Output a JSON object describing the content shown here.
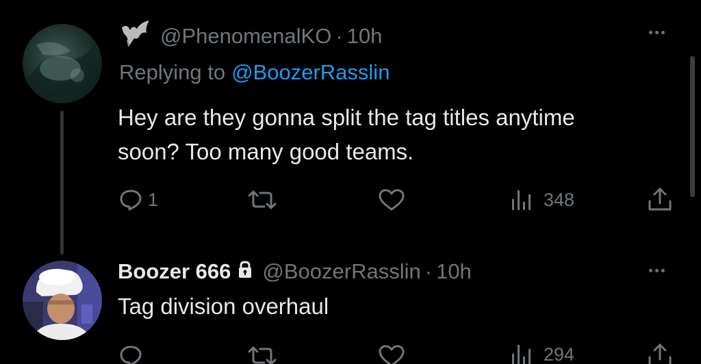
{
  "tweets": [
    {
      "handle": "@PhenomenalKO",
      "separator": "·",
      "time": "10h",
      "replying_prefix": "Replying to",
      "replying_handle": "@BoozerRasslin",
      "text_line1": "Hey are they gonna split the tag titles anytime",
      "text_line2": "soon? Too many good teams.",
      "actions": {
        "replies": "1",
        "views": "348"
      }
    },
    {
      "display_name": "Boozer 666",
      "handle": "@BoozerRasslin",
      "separator": "·",
      "time": "10h",
      "text": "Tag division overhaul",
      "actions": {
        "views": "294"
      }
    }
  ],
  "icons": {
    "badge": "bat-icon",
    "locked": "lock-icon",
    "reply": "reply-icon",
    "retweet": "retweet-icon",
    "like": "heart-icon",
    "views": "views-icon",
    "share": "share-icon",
    "more": "more-icon"
  },
  "colors": {
    "background": "#000000",
    "text": "#e7e9ea",
    "secondary": "#71767b",
    "link": "#1d9bf0"
  }
}
